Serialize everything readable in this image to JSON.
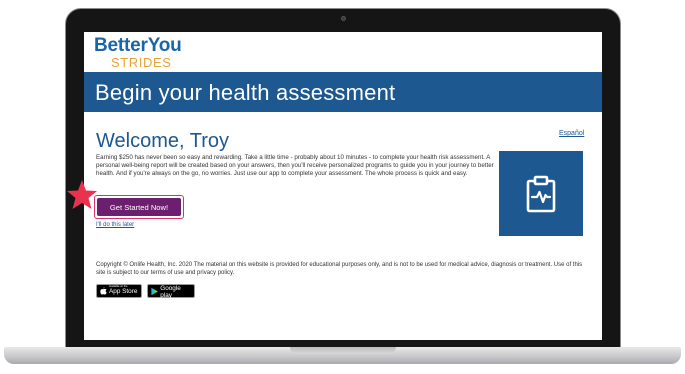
{
  "logo": {
    "main": "BetterYou",
    "sub": "STRIDES"
  },
  "banner": {
    "title": "Begin your health assessment"
  },
  "language_link": "Español",
  "welcome": "Welcome, Troy",
  "intro_text": "Earning $250 has never been so easy and rewarding. Take a little time - probably about 10 minutes - to complete your health risk assessment. A personal well-being report will be created based on your answers, then you'll receive personalized programs to guide you in your journey to better health. And if you're always on the go, no worries. Just use our app to complete your assessment. The whole process is quick and easy.",
  "cta_label": "Get Started Now!",
  "later_link": "I'll do this later",
  "copyright": "Copyright © Onlife Health, Inc. 2020 The material on this website is provided for educational purposes only, and is not to be used for medical advice, diagnosis or treatment. Use of this site is subject to our terms of use and privacy policy.",
  "badges": {
    "apple_small": "Available on the",
    "apple_big": "App Store",
    "google_small": "ANDROID APP ON",
    "google_big": "Google play"
  },
  "icons": {
    "assessment": "clipboard-heartbeat-icon",
    "annotation": "star-icon",
    "apple": "apple-icon",
    "google": "play-triangle-icon"
  },
  "colors": {
    "brand_blue": "#1d5891",
    "logo_blue": "#1a64a8",
    "logo_orange": "#e8a33a",
    "cta_purple": "#6b1f6e",
    "highlight_pink": "#d8326c"
  }
}
